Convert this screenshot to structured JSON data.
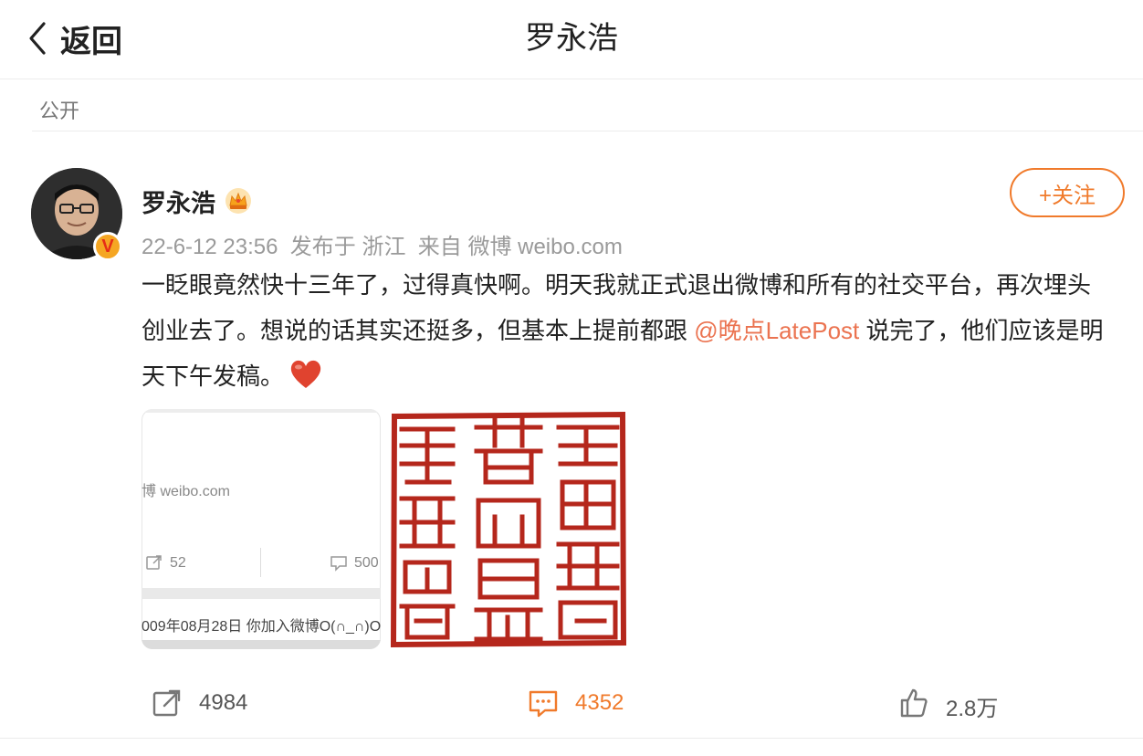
{
  "header": {
    "back_label": "返回",
    "title": "罗永浩"
  },
  "visibility": "公开",
  "post": {
    "author": "罗永浩",
    "follow_label": "+关注",
    "meta": "22-6-12 23:56  发布于 浙江  来自 微博 weibo.com",
    "text_part1": "一眨眼竟然快十三年了，过得真快啊。明天我就正式退出微博和所有的社交平台，再次埋头创业去了。想说的话其实还挺多，但基本上提前都跟 ",
    "mention": "@晚点LatePost",
    "text_part2": " 说完了，他们应该是明天下午发稿。",
    "image1": {
      "source_text": "博 weibo.com",
      "repost_count": "52",
      "comment_count": "500",
      "join_text": "009年08月28日 你加入微博O(∩_∩)O"
    }
  },
  "actions": {
    "repost_count": "4984",
    "comment_count": "4352",
    "like_count": "2.8万"
  },
  "colors": {
    "accent_orange": "#f07a2b",
    "mention": "#eb7350",
    "seal_red": "#b5271c"
  }
}
